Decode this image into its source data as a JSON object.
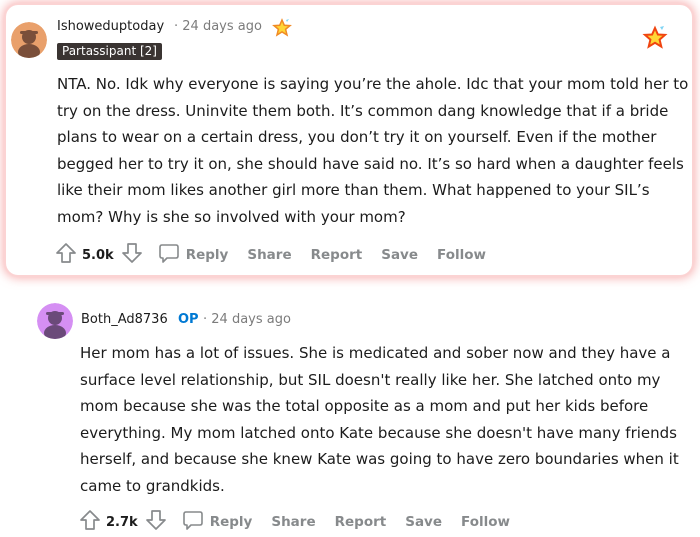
{
  "comments": [
    {
      "username": "Ishoweduptoday",
      "meta": "· 24 days ago",
      "flair": "Partassipant [2]",
      "body": "NTA. No. Idk why everyone is saying you’re the ahole. Idc that your mom told her to try on the dress. Uninvite them both. It’s common dang knowledge that if a bride plans to wear on a certain dress, you don’t try it on yourself. Even if the mother begged her to try it on, she should have said no. It’s so hard when a daughter feels like their mom likes another girl more than them. What happened to your SIL’s mom? Why is she so involved with your mom?",
      "score": "5.0k",
      "actions": {
        "reply": "Reply",
        "share": "Share",
        "report": "Report",
        "save": "Save",
        "follow": "Follow"
      }
    },
    {
      "username": "Both_Ad8736",
      "op_badge": "OP",
      "meta": "· 24 days ago",
      "body": "Her mom has a lot of issues. She is medicated and sober now and they have a surface level relationship, but SIL doesn't really like her. She latched onto my mom because she was the total opposite as a mom and put her kids before everything. My mom latched onto Kate because she doesn't have many friends herself, and because she knew Kate was going to have zero boundaries when it came to grandkids.",
      "score": "2.7k",
      "actions": {
        "reply": "Reply",
        "share": "Share",
        "report": "Report",
        "save": "Save",
        "follow": "Follow"
      }
    }
  ],
  "icons": {
    "upvote": "arrow-up-icon",
    "downvote": "arrow-down-icon",
    "reply": "chat-bubble-icon",
    "award": "star-award-icon"
  },
  "colors": {
    "op_badge": "#0079d3",
    "flair_bg": "#3a3432",
    "highlight_glow": "#f06e6e",
    "action_text": "#878a8c"
  }
}
